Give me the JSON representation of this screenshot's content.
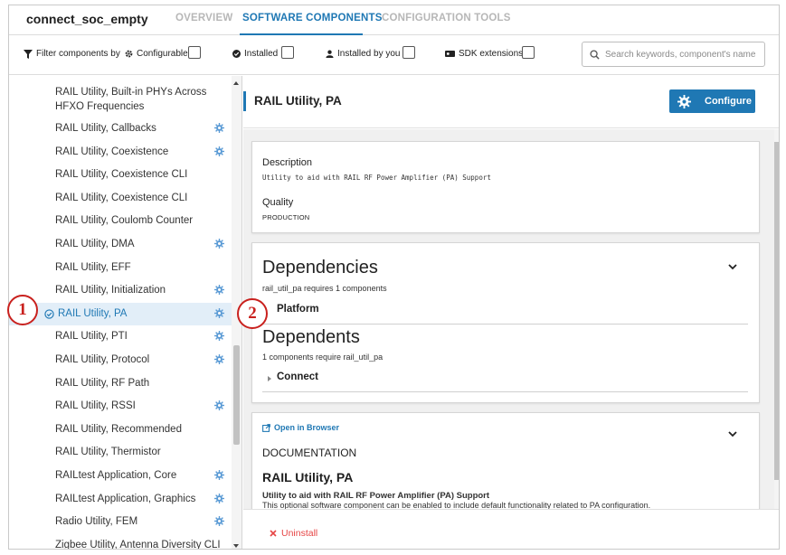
{
  "header": {
    "project_title": "connect_soc_empty",
    "tabs": [
      {
        "label": "OVERVIEW",
        "active": false
      },
      {
        "label": "SOFTWARE COMPONENTS",
        "active": true
      },
      {
        "label": "CONFIGURATION TOOLS",
        "active": false
      }
    ]
  },
  "filters": {
    "filter_by_label": "Filter components by",
    "configurable_label": "Configurable",
    "installed_label": "Installed",
    "installed_by_you_label": "Installed by you",
    "sdk_extensions_label": "SDK extensions",
    "search_placeholder": "Search keywords, component's name",
    "search_value": ""
  },
  "component_list": {
    "items": [
      {
        "label": "RAIL Utility, Built-in PHYs Across HFXO Frequencies",
        "configurable": false,
        "installed": false,
        "selected": false
      },
      {
        "label": "RAIL Utility, Callbacks",
        "configurable": true,
        "installed": false,
        "selected": false
      },
      {
        "label": "RAIL Utility, Coexistence",
        "configurable": true,
        "installed": false,
        "selected": false
      },
      {
        "label": "RAIL Utility, Coexistence CLI",
        "configurable": false,
        "installed": false,
        "selected": false
      },
      {
        "label": "RAIL Utility, Coexistence CLI",
        "configurable": false,
        "installed": false,
        "selected": false
      },
      {
        "label": "RAIL Utility, Coulomb Counter",
        "configurable": false,
        "installed": false,
        "selected": false
      },
      {
        "label": "RAIL Utility, DMA",
        "configurable": true,
        "installed": false,
        "selected": false
      },
      {
        "label": "RAIL Utility, EFF",
        "configurable": false,
        "installed": false,
        "selected": false
      },
      {
        "label": "RAIL Utility, Initialization",
        "configurable": true,
        "installed": false,
        "selected": false
      },
      {
        "label": "RAIL Utility, PA",
        "configurable": true,
        "installed": true,
        "selected": true
      },
      {
        "label": "RAIL Utility, PTI",
        "configurable": true,
        "installed": false,
        "selected": false
      },
      {
        "label": "RAIL Utility, Protocol",
        "configurable": true,
        "installed": false,
        "selected": false
      },
      {
        "label": "RAIL Utility, RF Path",
        "configurable": false,
        "installed": false,
        "selected": false
      },
      {
        "label": "RAIL Utility, RSSI",
        "configurable": true,
        "installed": false,
        "selected": false
      },
      {
        "label": "RAIL Utility, Recommended",
        "configurable": false,
        "installed": false,
        "selected": false
      },
      {
        "label": "RAIL Utility, Thermistor",
        "configurable": false,
        "installed": false,
        "selected": false
      },
      {
        "label": "RAILtest Application, Core",
        "configurable": true,
        "installed": false,
        "selected": false
      },
      {
        "label": "RAILtest Application, Graphics",
        "configurable": true,
        "installed": false,
        "selected": false
      },
      {
        "label": "Radio Utility, FEM",
        "configurable": true,
        "installed": false,
        "selected": false
      },
      {
        "label": "Zigbee Utility, Antenna Diversity CLI",
        "configurable": false,
        "installed": false,
        "selected": false
      }
    ]
  },
  "detail": {
    "title": "RAIL Utility, PA",
    "configure_label": "Configure",
    "description_label": "Description",
    "description_text": "Utility to aid with RAIL RF Power Amplifier (PA) Support",
    "quality_label": "Quality",
    "quality_value": "PRODUCTION",
    "dependencies_title": "Dependencies",
    "dependencies_summary": "rail_util_pa requires 1 components",
    "dependency_item": "Platform",
    "dependents_title": "Dependents",
    "dependents_summary": "1 components require rail_util_pa",
    "dependent_item": "Connect",
    "open_in_browser_label": "Open in Browser",
    "documentation_label": "DOCUMENTATION",
    "doc_title": "RAIL Utility, PA",
    "doc_subtitle": "Utility to aid with RAIL RF Power Amplifier (PA) Support",
    "doc_body": "This optional software component can be enabled to include default functionality related to PA configuration.",
    "uninstall_label": "Uninstall"
  },
  "callouts": {
    "marker_1": "1",
    "marker_2": "2"
  },
  "colors": {
    "accent": "#1f78b4",
    "selected_row": "#e2eef8",
    "uninstall": "#e64545",
    "callout": "#c9211e"
  }
}
